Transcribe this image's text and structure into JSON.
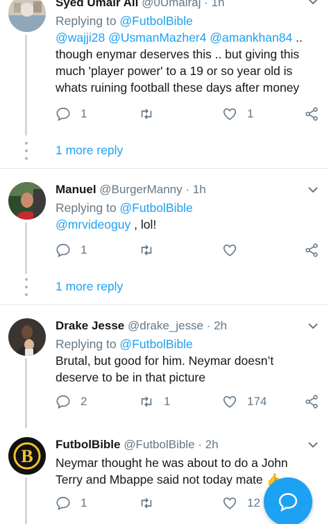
{
  "tweets": [
    {
      "name": "Syed Umair Ali",
      "handle": "@0Umairaj",
      "time": "1h",
      "replying_prefix": "Replying to ",
      "replying_to": "@FutbolBible",
      "mentions": "@wajji28 @UsmanMazher4 @amankhan84",
      "body_line1_suffix": " ..",
      "body_rest": "though enymar deserves this .. but giving this much 'player power' to a 19 or so year old is whats ruining football these days after money",
      "reply_count": "1",
      "retweet_count": "",
      "like_count": "1"
    },
    {
      "name": "Manuel",
      "handle": "@BurgerManny",
      "time": "1h",
      "replying_prefix": "Replying to ",
      "replying_to": "@FutbolBible",
      "mention": "@mrvideoguy",
      "body": " , lol!",
      "reply_count": "1",
      "retweet_count": "",
      "like_count": ""
    },
    {
      "name": "Drake Jesse",
      "handle": "@drake_jesse",
      "time": "2h",
      "replying_prefix": "Replying to ",
      "replying_to": "@FutbolBible",
      "body": "Brutal, but good for him. Neymar doesn’t deserve to be in that picture",
      "reply_count": "2",
      "retweet_count": "1",
      "like_count": "174"
    },
    {
      "name": "FutbolBible",
      "handle": "@FutbolBible",
      "time": "2h",
      "body": "Neymar thought he was about to do a John Terry and Mbappe said not today mate 👍",
      "reply_count": "1",
      "retweet_count": "",
      "like_count": "12"
    }
  ],
  "more_replies": [
    "1 more reply",
    "1 more reply"
  ],
  "dot_separator": "·",
  "colors": {
    "link": "#1da1f2",
    "muted": "#657786",
    "divider": "#e1e8ed",
    "fab": "#1da1f2"
  },
  "icons": [
    "reply-icon",
    "retweet-icon",
    "like-icon",
    "share-icon",
    "chevron-down-icon",
    "compose-reply-icon"
  ]
}
